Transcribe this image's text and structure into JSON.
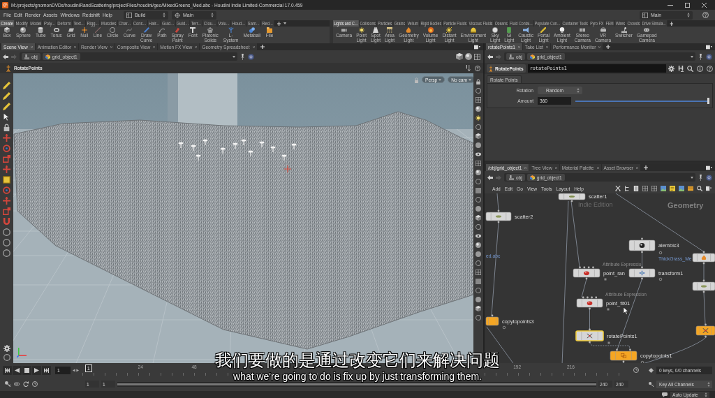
{
  "window": {
    "title": "M:/projects/gnomonDVDs/houdiniRandScattering/projectFiles/houdini/geo/MixedGreens_Med.abc - Houdini Indie Limited-Commercial 17.0.459"
  },
  "menu_bar": {
    "items": [
      "File",
      "Edit",
      "Render",
      "Assets",
      "Windows",
      "Redshift",
      "Help"
    ],
    "desktop": "Build",
    "shelf_set": "Main",
    "layout": "Main"
  },
  "shelves": [
    {
      "tabs": [
        {
          "label": "Create",
          "selected": true
        },
        {
          "label": "Modify",
          "selected": false
        },
        {
          "label": "Model",
          "selected": false
        },
        {
          "label": "Poly...",
          "selected": false
        },
        {
          "label": "Deform",
          "selected": false
        },
        {
          "label": "Text...",
          "selected": false
        },
        {
          "label": "Rigg...",
          "selected": false
        },
        {
          "label": "Muscles",
          "selected": false
        },
        {
          "label": "Char...",
          "selected": false
        },
        {
          "label": "Cons...",
          "selected": false
        },
        {
          "label": "Hair...",
          "selected": false
        },
        {
          "label": "Guid...",
          "selected": false
        },
        {
          "label": "Guid...",
          "selected": false
        },
        {
          "label": "Terr...",
          "selected": false
        },
        {
          "label": "Clou...",
          "selected": false
        },
        {
          "label": "Volu...",
          "selected": false
        },
        {
          "label": "Houd...",
          "selected": false
        },
        {
          "label": "Sam...",
          "selected": false
        },
        {
          "label": "Red...",
          "selected": false
        }
      ],
      "tools": [
        "Box",
        "Sphere",
        "Tube",
        "Torus",
        "Grid",
        "Null",
        "Line",
        "Circle",
        "Curve",
        "Draw Curve",
        "Path",
        "Spray Paint",
        "Font",
        "Platonic Solids",
        "L-System",
        "Metaball",
        "File"
      ]
    },
    {
      "tabs": [
        {
          "label": "Lights and C...",
          "selected": true
        },
        {
          "label": "Collisions",
          "selected": false
        },
        {
          "label": "Particles",
          "selected": false
        },
        {
          "label": "Grains",
          "selected": false
        },
        {
          "label": "Vellum",
          "selected": false
        },
        {
          "label": "Rigid Bodies",
          "selected": false
        },
        {
          "label": "Particle Fluids",
          "selected": false
        },
        {
          "label": "Viscous Fluids",
          "selected": false
        },
        {
          "label": "Oceans",
          "selected": false
        },
        {
          "label": "Fluid Contai...",
          "selected": false
        },
        {
          "label": "Populate Con...",
          "selected": false
        },
        {
          "label": "Container Tools",
          "selected": false
        },
        {
          "label": "Pyro FX",
          "selected": false
        },
        {
          "label": "FEM",
          "selected": false
        },
        {
          "label": "Wires",
          "selected": false
        },
        {
          "label": "Crowds",
          "selected": false
        },
        {
          "label": "Drive Simula...",
          "selected": false
        }
      ],
      "tools": [
        "Camera",
        "Point Light",
        "Spot Light",
        "Area Light",
        "Geometry Light",
        "Volume Light",
        "Distant Light",
        "Environment Light",
        "Sky Light",
        "GI Light",
        "Caustic Light",
        "Portal Light",
        "Ambient Light",
        "Stereo Camera",
        "VR Camera",
        "Switcher",
        "Gamepad Camera"
      ]
    }
  ],
  "scene_pane": {
    "tabs": [
      {
        "label": "Scene View",
        "selected": true
      },
      {
        "label": "Animation Editor",
        "selected": false
      },
      {
        "label": "Render View",
        "selected": false
      },
      {
        "label": "Composite View",
        "selected": false
      },
      {
        "label": "Motion FX View",
        "selected": false
      },
      {
        "label": "Geometry Spreadsheet",
        "selected": false
      }
    ],
    "path": [
      "obj",
      "grid_object1"
    ],
    "tool": "RotatePoints",
    "view_menus": [
      "Persp",
      "No cam"
    ]
  },
  "parameter_pane": {
    "tabs": [
      {
        "label": "rotatePoints1",
        "selected": true
      },
      {
        "label": "Take List",
        "selected": false
      },
      {
        "label": "Performance Monitor",
        "selected": false
      }
    ],
    "path": [
      "obj",
      "grid_object1"
    ],
    "node_type": "RotatePoints",
    "node_name": "rotatePoints1",
    "folder": "Rotate Points",
    "parameters": [
      {
        "kind": "menu",
        "label": "Rotation",
        "value": "Random"
      },
      {
        "kind": "slider",
        "label": "Amount",
        "value": "360",
        "level": 1
      }
    ]
  },
  "network_pane": {
    "tabs": [
      {
        "label": "/obj/grid_object1",
        "selected": true
      },
      {
        "label": "Tree View",
        "selected": false
      },
      {
        "label": "Material Palette",
        "selected": false
      },
      {
        "label": "Asset Browser",
        "selected": false
      }
    ],
    "path": [
      "obj",
      "grid_object1"
    ],
    "menu": [
      "Add",
      "Edit",
      "Go",
      "View",
      "Tools",
      "Layout",
      "Help"
    ],
    "edition": "Indie Edition",
    "context": "Geometry",
    "file_labels": [
      "ed.abc",
      "ThickGrass_Me"
    ],
    "nodes": [
      {
        "name": "scatter1",
        "color": "#d6d6d6",
        "selected": false
      },
      {
        "name": "scatter2",
        "color": "#d6d6d6",
        "selected": false
      },
      {
        "name": "alembic3",
        "color": "#d6d6d6",
        "selected": false
      },
      {
        "color": "#d6d6d6",
        "selected": false
      },
      {
        "name": "point_ran",
        "comment": "Attribute Expressio",
        "color": "#d6d6d6",
        "selected": false
      },
      {
        "name": "transform1",
        "color": "#d6d6d6",
        "selected": false
      },
      {
        "color": "#d6d6d6",
        "selected": false
      },
      {
        "name": "point_fit01",
        "comment": "Attribute Expression",
        "color": "#d6d6d6",
        "selected": false
      },
      {
        "name": "copytopoints3",
        "color": "#f5a623",
        "selected": false
      },
      {
        "name": "rotatePoints1",
        "color": "#d6d6d6",
        "selected": true
      },
      {
        "color": "#f5a623",
        "selected": false
      },
      {
        "name": "copytopoints1",
        "color": "#f5a623",
        "selected": false
      }
    ]
  },
  "subtitles": [
    "我们要做的是通过改变它们来解决问题",
    "what we're going to do is fix up by just transforming them."
  ],
  "timeline": {
    "frame": "1",
    "frame_marker": "1",
    "ticks": [
      "24",
      "48",
      "192",
      "216"
    ],
    "range_start": [
      "1",
      "1"
    ],
    "range_end": [
      "240",
      "240"
    ],
    "keys_info": "0 keys, 0/0 channels",
    "key_mode": "Key All Channels"
  },
  "status_bar": {
    "update_mode": "Auto Update"
  }
}
